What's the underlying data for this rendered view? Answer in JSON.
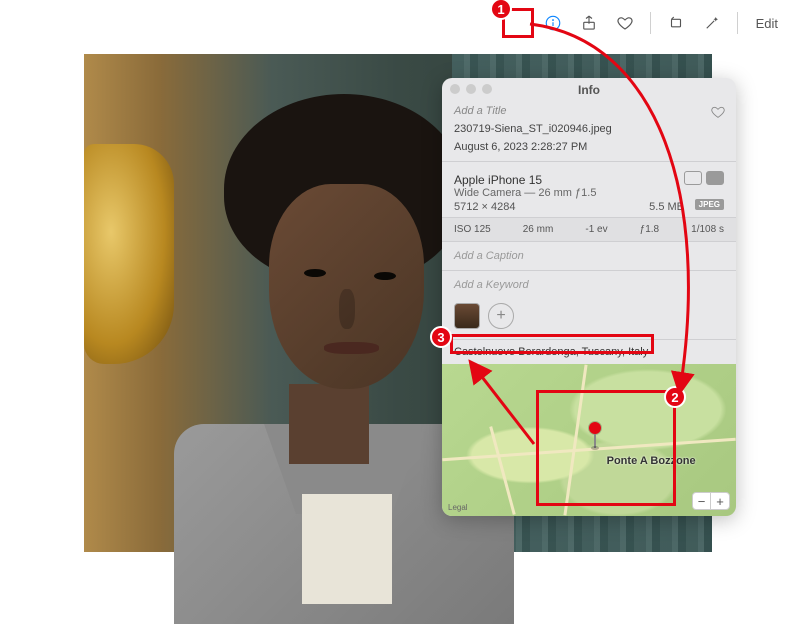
{
  "toolbar": {
    "edit_label": "Edit"
  },
  "panel": {
    "header": "Info",
    "title_placeholder": "Add a Title",
    "filename": "230719-Siena_ST_i020946.jpeg",
    "datetime": "August 6, 2023  2:28:27 PM",
    "camera": {
      "device": "Apple iPhone 15",
      "lens": "Wide Camera — 26 mm ƒ1.5",
      "dimensions": "5712 × 4284",
      "filesize": "5.5 MB",
      "format_badge": "JPEG",
      "exif": {
        "iso": "ISO 125",
        "focal": "26 mm",
        "ev": "-1 ev",
        "aperture": "ƒ1.8",
        "shutter": "1/108 s"
      }
    },
    "caption_placeholder": "Add a Caption",
    "keyword_placeholder": "Add a Keyword",
    "location_text": "Castelnuovo Berardenga, Tuscany, Italy",
    "map": {
      "place_label": "Ponte A Bozzone",
      "legal": "Legal",
      "zoom_out": "−",
      "zoom_in": "+"
    }
  },
  "annotations": {
    "step1": "1",
    "step2": "2",
    "step3": "3"
  }
}
